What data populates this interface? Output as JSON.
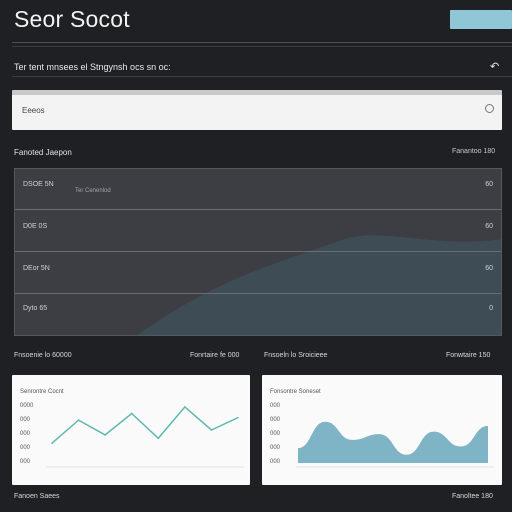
{
  "header": {
    "title": "Seor Socot",
    "button_label": ""
  },
  "subtitle": "Ter tent mnsees el Stngynsh ocs sn oc:",
  "search": {
    "placeholder": "Eeeos"
  },
  "overview": {
    "left_label": "Fanoted Jaepon",
    "right_label": "Fanantoo 180"
  },
  "panel": {
    "note": "Ter Cenenlod",
    "rows": [
      {
        "label": "DSOE 5N",
        "value": "60"
      },
      {
        "label": "D0E 0S",
        "value": "60"
      },
      {
        "label": "DEor 5N",
        "value": "60"
      },
      {
        "label": "Dyto 65",
        "value": "0"
      }
    ]
  },
  "charts": {
    "left": {
      "caption": "Fnsoenie lo 60000",
      "right_caption": "Fonrtaire fe 000",
      "title": "Senrontre Cocnt",
      "yticks": [
        "0000",
        "000",
        "000",
        "000",
        "000"
      ]
    },
    "right": {
      "caption": "Fnsoeln lo Sroicieee",
      "right_caption": "Fonwtaire 150",
      "title": "Fonsontre Soneset",
      "yticks": [
        "000",
        "000",
        "000",
        "000",
        "000"
      ]
    }
  },
  "footer": {
    "left": "Fanoen Saees",
    "right": "Fanoltee 180"
  },
  "chart_data": [
    {
      "type": "line",
      "series": [
        {
          "values": [
            24,
            52,
            34,
            60,
            30,
            68,
            40,
            55
          ]
        }
      ]
    },
    {
      "type": "area",
      "series": [
        {
          "values": [
            18,
            50,
            28,
            35,
            10,
            38,
            20,
            45
          ]
        }
      ]
    }
  ],
  "colors": {
    "accent": "#8fc7d6",
    "line": "#5fb7b0",
    "area": "#7fb4c6"
  }
}
